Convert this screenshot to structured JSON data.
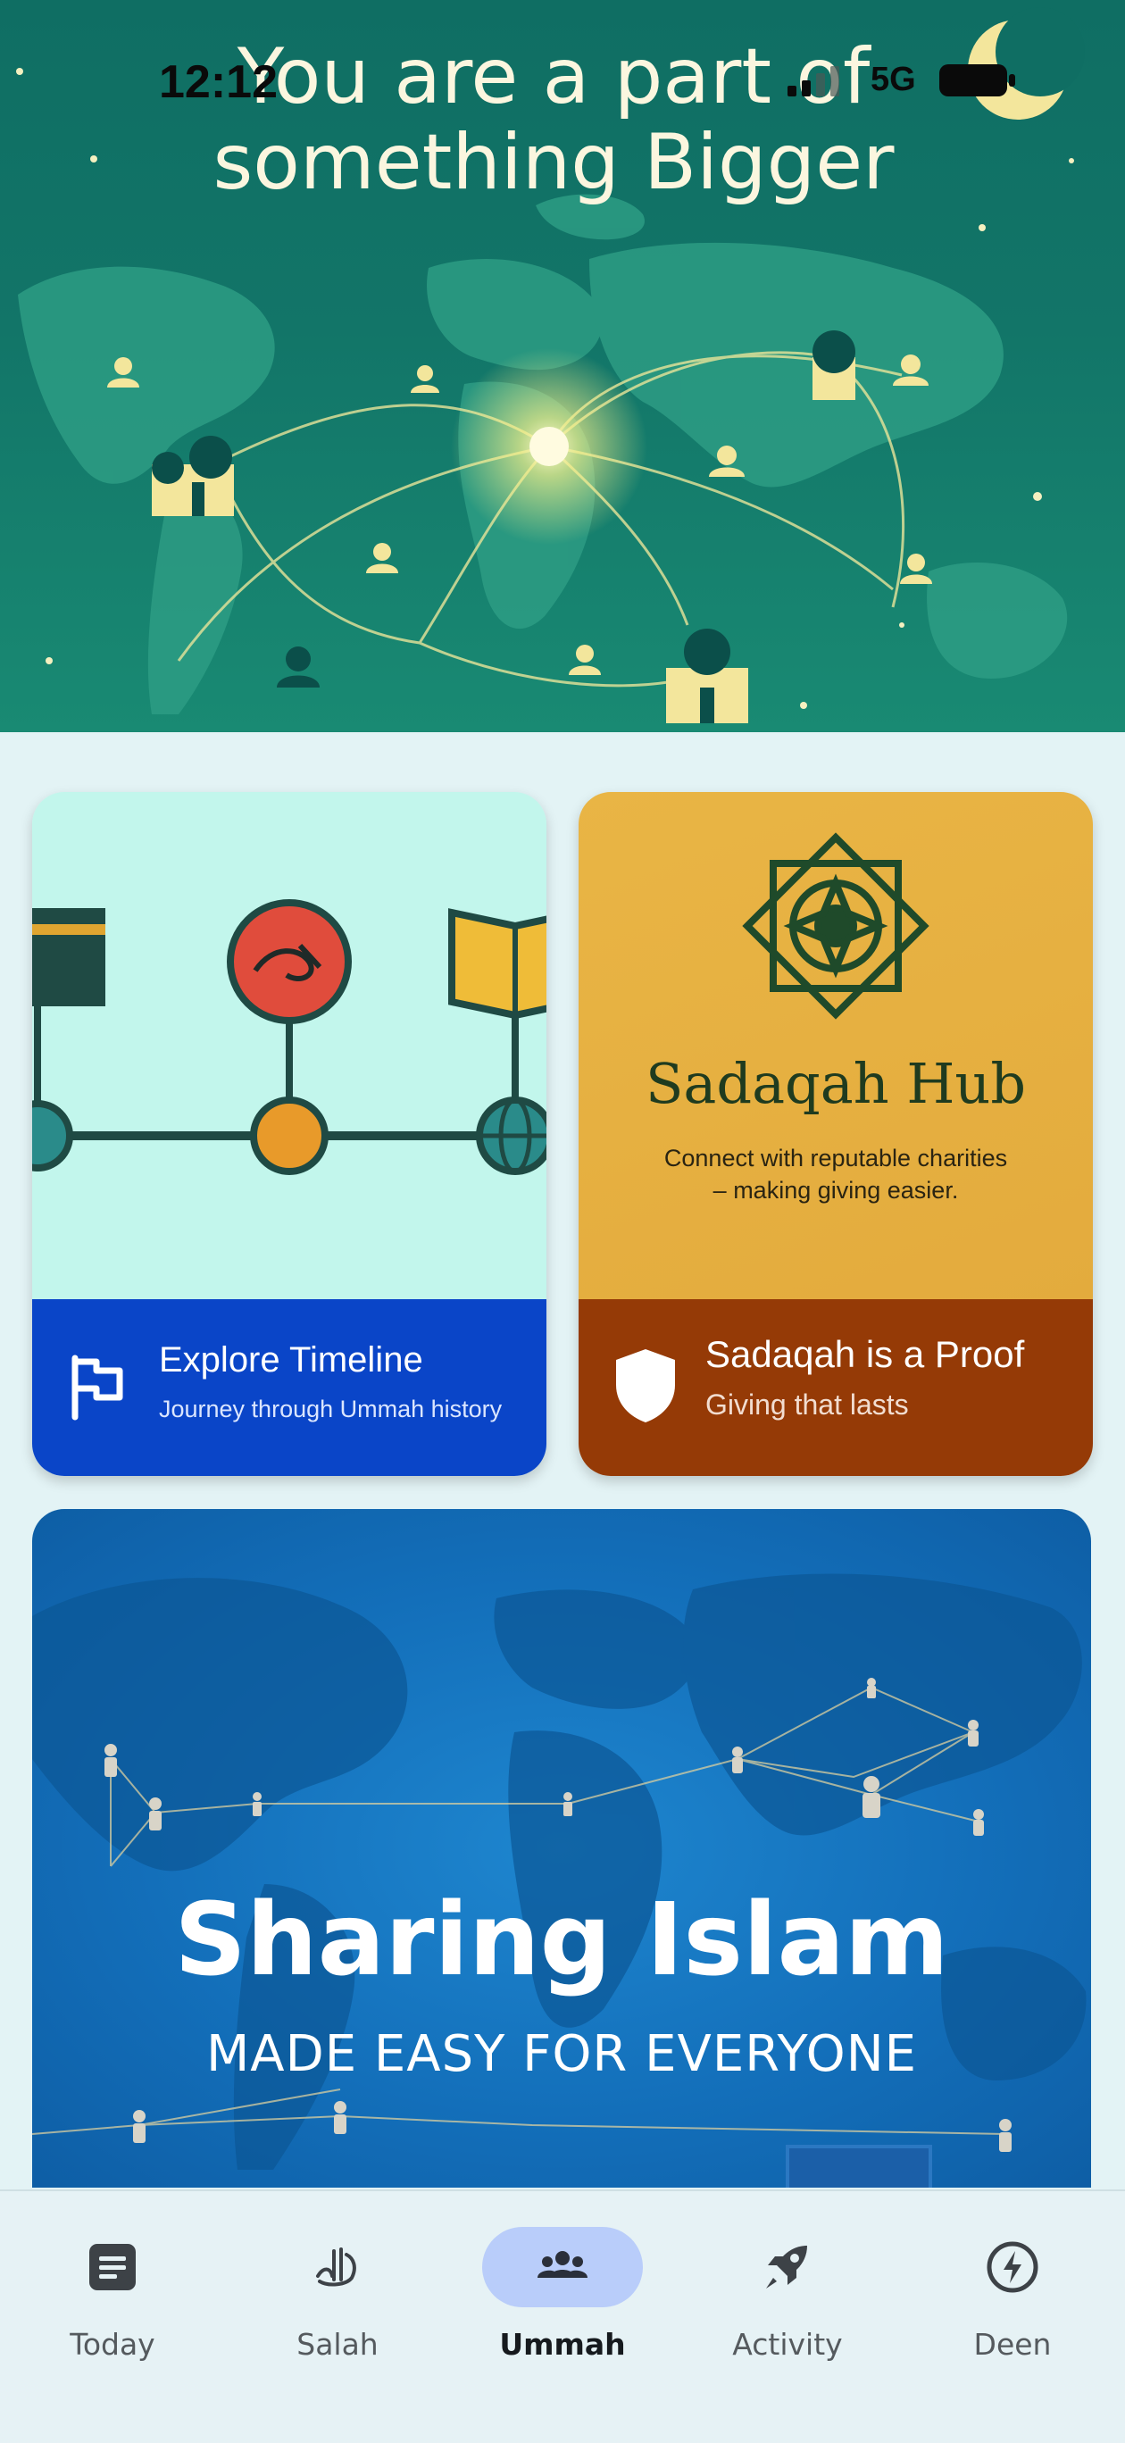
{
  "status_bar": {
    "time": "12:12",
    "network": "5G"
  },
  "hero": {
    "title_line1": "You are a part of",
    "title_line2": "something Bigger"
  },
  "cards": {
    "timeline": {
      "title": "Explore Timeline",
      "subtitle": "Journey through Ummah history",
      "icon": "flag-icon"
    },
    "sadaqah": {
      "hub_title": "Sadaqah Hub",
      "hub_desc_line1": "Connect with reputable charities",
      "hub_desc_line2": "– making giving easier.",
      "title": "Sadaqah is a Proof",
      "subtitle": "Giving that lasts",
      "icon": "shield-icon"
    }
  },
  "banner": {
    "title": "Sharing Islam",
    "subtitle": "MADE EASY FOR EVERYONE"
  },
  "tabs": [
    {
      "label": "Today",
      "icon": "document-icon",
      "active": false
    },
    {
      "label": "Salah",
      "icon": "calligraphy-icon",
      "active": false
    },
    {
      "label": "Ummah",
      "icon": "people-icon",
      "active": true
    },
    {
      "label": "Activity",
      "icon": "rocket-icon",
      "active": false
    },
    {
      "label": "Deen",
      "icon": "bolt-icon",
      "active": false
    }
  ],
  "colors": {
    "hero_bg": "#127568",
    "timeline_footer": "#0a45c8",
    "sadaqah_footer": "#953a06",
    "banner_bg": "#136fba",
    "active_tab_pill": "#b9cdfa"
  }
}
